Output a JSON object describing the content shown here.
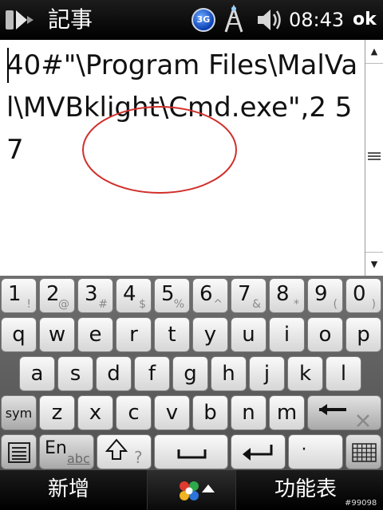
{
  "titlebar": {
    "app_title": "記事",
    "network_badge": "3G",
    "clock": "08:43",
    "ok_label": "ok",
    "icons": [
      "start-flag-icon",
      "signal-icon",
      "volume-icon"
    ]
  },
  "document": {
    "text": "40#\"\\Program Files\\MalVal\\MVBklight\\Cmd.exe\",2 5 7",
    "annotation_color": "#d0302c"
  },
  "keyboard": {
    "row_numbers": [
      {
        "main": "1",
        "alt": "!"
      },
      {
        "main": "2",
        "alt": "@"
      },
      {
        "main": "3",
        "alt": "#"
      },
      {
        "main": "4",
        "alt": "$"
      },
      {
        "main": "5",
        "alt": "%"
      },
      {
        "main": "6",
        "alt": "^"
      },
      {
        "main": "7",
        "alt": "&"
      },
      {
        "main": "8",
        "alt": "*"
      },
      {
        "main": "9",
        "alt": "("
      },
      {
        "main": "0",
        "alt": ")"
      }
    ],
    "row_qwerty": [
      "q",
      "w",
      "e",
      "r",
      "t",
      "y",
      "u",
      "i",
      "o",
      "p"
    ],
    "row_asdf": [
      "a",
      "s",
      "d",
      "f",
      "g",
      "h",
      "j",
      "k",
      "l"
    ],
    "row_zxcv": [
      "z",
      "x",
      "c",
      "v",
      "b",
      "n",
      "m"
    ],
    "sym_label": "sym",
    "lang_main": "En",
    "lang_sub": "abc",
    "question_mark": "?",
    "dot_label": "·"
  },
  "softkeys": {
    "left": "新增",
    "right": "功能表"
  },
  "watermark": "#99098"
}
